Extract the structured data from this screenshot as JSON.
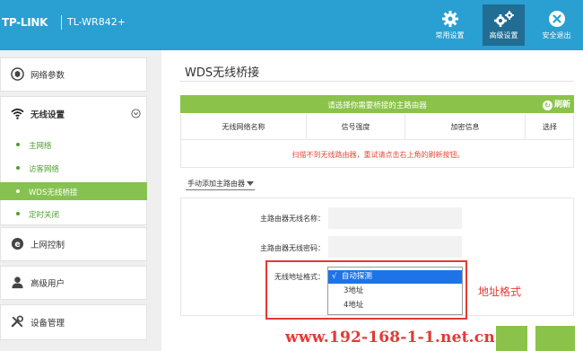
{
  "header": {
    "brand": "TP-LINK",
    "model": "TL-WR842+",
    "buttons": [
      {
        "label": "常用设置",
        "icon": "gear-icon",
        "active": false
      },
      {
        "label": "高级设置",
        "icon": "gears-icon",
        "active": true
      },
      {
        "label": "安全退出",
        "icon": "close-icon",
        "active": false
      }
    ]
  },
  "sidebar": {
    "items": [
      {
        "label": "网络参数",
        "icon": "network-icon"
      },
      {
        "label": "无线设置",
        "icon": "wifi-icon"
      },
      {
        "label": "上网控制",
        "icon": "internet-control-icon"
      },
      {
        "label": "高级用户",
        "icon": "user-icon"
      },
      {
        "label": "设备管理",
        "icon": "tools-icon"
      }
    ],
    "wireless_sub": [
      {
        "label": "主网络",
        "active": false
      },
      {
        "label": "访客网络",
        "active": false
      },
      {
        "label": "WDS无线桥接",
        "active": true
      },
      {
        "label": "定时关闭",
        "active": false
      }
    ]
  },
  "main": {
    "title": "WDS无线桥接",
    "select_router_prompt": "请选择你需要桥接的主路由器",
    "refresh": "刷新",
    "columns": [
      "无线网络名称",
      "信号强度",
      "加密信息",
      "选择"
    ],
    "empty_message": "扫描不到无线路由器，重试请点击右上角的刷新按钮。",
    "manual_add": "手动添加主路由器",
    "fields": {
      "ssid_label": "主路由器无线名称：",
      "password_label": "主路由器无线密码：",
      "addr_format_label": "无线地址格式："
    },
    "addr_format_options": [
      {
        "label": "自动探测",
        "selected": true
      },
      {
        "label": "3地址",
        "selected": false
      },
      {
        "label": "4地址",
        "selected": false
      }
    ]
  },
  "annotation": "地址格式",
  "watermark": "www.192-168-1-1.net.cn",
  "colors": {
    "header": "#2a9fd1",
    "header_active": "#216d94",
    "accent_green": "#8bc34a",
    "error_red": "#e34a3b",
    "select_blue": "#1e73e8"
  }
}
